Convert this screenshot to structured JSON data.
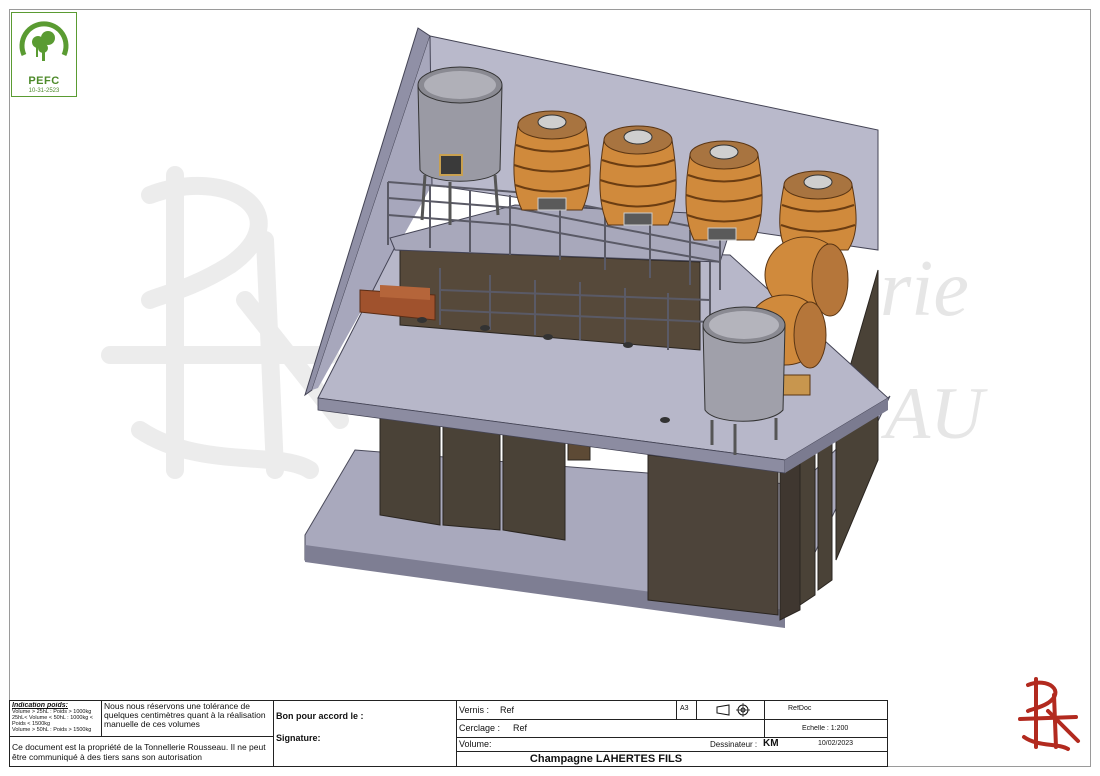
{
  "certification": {
    "name": "PEFC",
    "code": "10-31-2523",
    "color": "#4d8a2a"
  },
  "watermark": {
    "text_line1": "rie",
    "text_line2": "AU"
  },
  "title_block": {
    "weight_info": {
      "title": "Indication poids:",
      "lines": [
        "Volume > 25hL : Poids > 1000kg",
        "25hL< Volume < 50hL : 1000kg <",
        "Poids < 1500kg",
        "Volume > 50hL : Poids > 1500kg"
      ]
    },
    "tolerance_note": "Nous nous réservons une tolérance de quelques centimètres quant à la réalisation manuelle de ces volumes",
    "property_note": "Ce document est la propriété de la Tonnellerie Rousseau. Il ne peut être communiqué à des tiers sans son autorisation",
    "approval_label": "Bon pour accord le :",
    "signature_label": "Signature:",
    "vernis_label": "Vernis :",
    "vernis_value": "Ref",
    "cerclage_label": "Cerclage :",
    "cerclage_value": "Ref",
    "volume_label": "Volume:",
    "sheet_format": "A3",
    "ref_doc": "RefDoc",
    "scale": "Echelle : 1:200",
    "drawer_label": "Dessinateur :",
    "drawer_value": "KM",
    "date": "10/02/2023",
    "project": "Champagne LAHERTES FILS"
  }
}
